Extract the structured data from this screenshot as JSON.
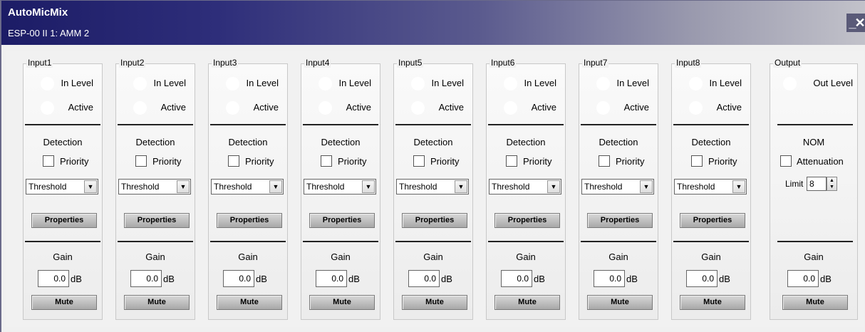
{
  "window": {
    "title": "AutoMicMix",
    "subtitle": "ESP-00 II 1: AMM 2",
    "controls": "_✕"
  },
  "inputs": [
    {
      "label": "Input1",
      "in_level": "In Level",
      "active": "Active",
      "detection": "Detection",
      "priority": "Priority",
      "mode": "Threshold",
      "properties": "Properties",
      "gain_label": "Gain",
      "gain_value": "0.0",
      "gain_unit": "dB",
      "mute": "Mute"
    },
    {
      "label": "Input2",
      "in_level": "In Level",
      "active": "Active",
      "detection": "Detection",
      "priority": "Priority",
      "mode": "Threshold",
      "properties": "Properties",
      "gain_label": "Gain",
      "gain_value": "0.0",
      "gain_unit": "dB",
      "mute": "Mute"
    },
    {
      "label": "Input3",
      "in_level": "In Level",
      "active": "Active",
      "detection": "Detection",
      "priority": "Priority",
      "mode": "Threshold",
      "properties": "Properties",
      "gain_label": "Gain",
      "gain_value": "0.0",
      "gain_unit": "dB",
      "mute": "Mute"
    },
    {
      "label": "Input4",
      "in_level": "In Level",
      "active": "Active",
      "detection": "Detection",
      "priority": "Priority",
      "mode": "Threshold",
      "properties": "Properties",
      "gain_label": "Gain",
      "gain_value": "0.0",
      "gain_unit": "dB",
      "mute": "Mute"
    },
    {
      "label": "Input5",
      "in_level": "In Level",
      "active": "Active",
      "detection": "Detection",
      "priority": "Priority",
      "mode": "Threshold",
      "properties": "Properties",
      "gain_label": "Gain",
      "gain_value": "0.0",
      "gain_unit": "dB",
      "mute": "Mute"
    },
    {
      "label": "Input6",
      "in_level": "In Level",
      "active": "Active",
      "detection": "Detection",
      "priority": "Priority",
      "mode": "Threshold",
      "properties": "Properties",
      "gain_label": "Gain",
      "gain_value": "0.0",
      "gain_unit": "dB",
      "mute": "Mute"
    },
    {
      "label": "Input7",
      "in_level": "In Level",
      "active": "Active",
      "detection": "Detection",
      "priority": "Priority",
      "mode": "Threshold",
      "properties": "Properties",
      "gain_label": "Gain",
      "gain_value": "0.0",
      "gain_unit": "dB",
      "mute": "Mute"
    },
    {
      "label": "Input8",
      "in_level": "In Level",
      "active": "Active",
      "detection": "Detection",
      "priority": "Priority",
      "mode": "Threshold",
      "properties": "Properties",
      "gain_label": "Gain",
      "gain_value": "0.0",
      "gain_unit": "dB",
      "mute": "Mute"
    }
  ],
  "output": {
    "label": "Output",
    "out_level": "Out Level",
    "nom": "NOM",
    "attenuation": "Attenuation",
    "limit_label": "Limit",
    "limit_value": "8",
    "gain_label": "Gain",
    "gain_value": "0.0",
    "gain_unit": "dB",
    "mute": "Mute"
  },
  "colors": {
    "title_bar_start": "#1c1c66",
    "title_bar_end": "#c2c2ca",
    "led_off": "#ffffff"
  },
  "icons": {
    "dropdown_arrow": "▼",
    "spin_up": "▲",
    "spin_down": "▼"
  }
}
